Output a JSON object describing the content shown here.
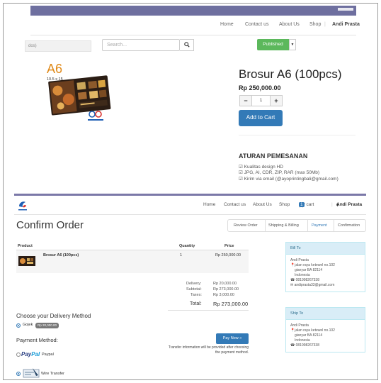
{
  "top": {
    "nav": [
      "Home",
      "Contact us",
      "About Us",
      "Shop"
    ],
    "user": "Andi Prasta",
    "filter_text": "dos)",
    "search_placeholder": "Search...",
    "published_label": "Published",
    "image_label": "A6",
    "image_sublabel": "10.5 x 15",
    "product_title": "Brosur A6 (100pcs)",
    "price": "Rp 250,000.00",
    "qty": "1",
    "minus": "−",
    "plus": "+",
    "add_to_cart": "Add to Cart",
    "rules_title": "ATURAN PEMESANAN",
    "rules": [
      "Kualitas design HD",
      "JPG, AI, CDR, ZIP, RAR (max 50Mb)",
      "Kirim via email (@ayoprintingbali@gmail.com)"
    ]
  },
  "bottom": {
    "nav": [
      "Home",
      "Contact us",
      "About Us",
      "Shop"
    ],
    "cart_label": "My cart",
    "cart_count": "1",
    "user": "Andi Prasta",
    "title": "Confirm Order",
    "steps": [
      "Review Order",
      "Shipping & Billing",
      "Payment",
      "Confirmation"
    ],
    "table_headers": [
      "Product",
      "Quantity",
      "Price"
    ],
    "line_item": {
      "name": "Brosur A6 (100pcs)",
      "quantity": "1",
      "price": "Rp 250,000.00"
    },
    "totals": [
      {
        "label": "Delivery:",
        "value": "Rp 20,000.00"
      },
      {
        "label": "Subtotal:",
        "value": "Rp 273,000.00"
      },
      {
        "label": "Taxes:",
        "value": "Rp 3,000.00"
      }
    ],
    "total_label": "Total:",
    "total_value": "Rp 273,000.00",
    "delivery_heading": "Choose your Delivery Method",
    "delivery_option": "Gojek",
    "delivery_badge": "Rp 20,000.00",
    "payment_heading": "Payment Method:",
    "paypal_logo_a": "Pay",
    "paypal_logo_b": "Pal",
    "paypal_label": "Paypal",
    "wire_label": "Wire Transfer",
    "pay_now": "Pay Now »",
    "transfer_info": "Transfer information will be provided after choosing the payment method.",
    "bill_to": {
      "heading": "Bill To",
      "name": "Andi Prasta",
      "address1": "jalan raya ketewel no.102",
      "address2": "gianyar BA 82114",
      "country": "Indonesia",
      "phone": "081998267338",
      "email": "andiprasta33@gmail.com"
    },
    "ship_to": {
      "heading": "Ship To",
      "name": "Andi Prasta",
      "address1": "jalan raya ketewel no.102",
      "address2": "gianyar BA 82114",
      "country": "Indonesia",
      "phone": "081998267338"
    }
  },
  "colors": {
    "header_bar": "#6e6f9f",
    "primary": "#337ab7",
    "success": "#5cb85c",
    "panel_head": "#d9edf7"
  }
}
